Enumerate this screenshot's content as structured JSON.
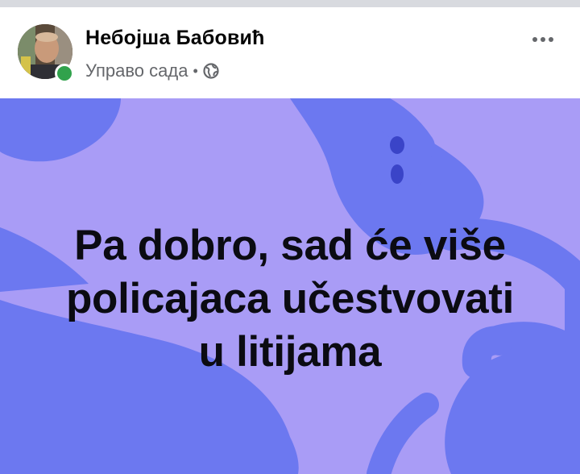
{
  "post": {
    "author_name": "Небојша Бабовић",
    "time_label": "Управо сада",
    "separator": "•",
    "audience_icon": "globe-icon",
    "more_icon": "more-options-icon",
    "online_status": "online",
    "text_lines": [
      "Pa dobro, sad će više",
      "policajaca učestvovati",
      "u litijama"
    ],
    "background_color": "#a99cf6",
    "shape_color": "#6c78f0",
    "nail_color": "#3a44c8"
  }
}
